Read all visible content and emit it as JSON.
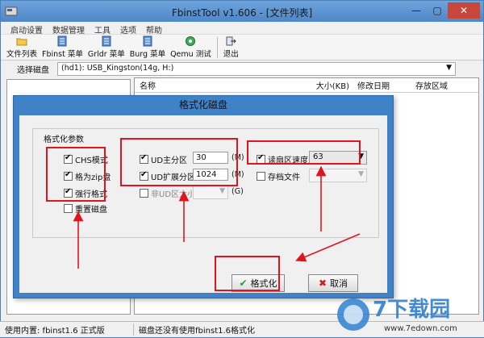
{
  "window": {
    "title": "FbinstTool v1.606 - [文件列表]",
    "buttons": {
      "minimize": "—",
      "maximize": "▢",
      "close": "✕"
    }
  },
  "menu": [
    "启动设置",
    "数据管理",
    "工具",
    "选项",
    "帮助"
  ],
  "toolbar": [
    {
      "label": "文件列表",
      "icon": "folder-icon"
    },
    {
      "label": "Fbinst 菜单",
      "icon": "menu-doc-icon"
    },
    {
      "label": "Grldr 菜单",
      "icon": "menu-doc-icon"
    },
    {
      "label": "Burg 菜单",
      "icon": "menu-doc-icon"
    },
    {
      "label": "Qemu 测试",
      "icon": "qemu-icon"
    },
    {
      "label": "退出",
      "icon": "exit-icon"
    }
  ],
  "disk": {
    "label": "选择磁盘",
    "value": "(hd1): USB_Kingston(14g, H:)"
  },
  "list": {
    "columns": [
      "名称",
      "大小(KB)",
      "修改日期",
      "存放区域"
    ]
  },
  "dialog": {
    "title": "格式化磁盘",
    "group_label": "格式化参数",
    "options": {
      "chs": {
        "label": "CHS模式",
        "checked": true
      },
      "zip": {
        "label": "格为zip盘",
        "checked": true
      },
      "force": {
        "label": "强行格式",
        "checked": true
      },
      "reset": {
        "label": "重置磁盘",
        "checked": false
      }
    },
    "ud_primary": {
      "label": "UD主分区",
      "value": "30",
      "unit": "(M)",
      "checked": true
    },
    "ud_extended": {
      "label": "UD扩展分区",
      "value": "1024",
      "unit": "(M)",
      "checked": true
    },
    "non_ud": {
      "label": "非UD区大小",
      "unit": "(G)",
      "checked": false
    },
    "read_speed": {
      "label": "读扇区速度",
      "value": "63",
      "checked": true
    },
    "archive": {
      "label": "存档文件",
      "checked": false
    },
    "format_button": "格式化",
    "cancel_button": "取消"
  },
  "status": {
    "left": "使用内置: fbinst1.6 正式版",
    "right": "磁盘还没有使用fbinst1.6格式化"
  },
  "watermark": {
    "text": "7下载园",
    "url": "www.7edown.com"
  },
  "colors": {
    "accent": "#3f82c8",
    "highlight": "#e0141e",
    "titlebar": "#5a92d2"
  }
}
